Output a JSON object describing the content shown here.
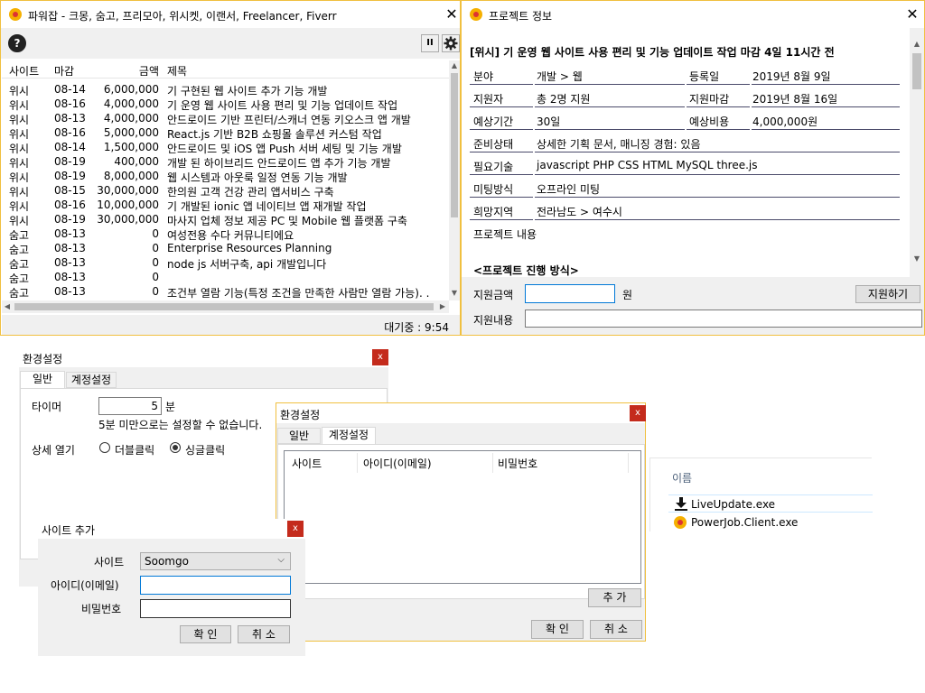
{
  "main_window": {
    "title": "파워잡 - 크몽, 숨고, 프리모아, 위시켓, 이랜서, Freelancer, Fiverr",
    "help_label": "?",
    "pause_label": "II",
    "settings_icon": "gear-icon",
    "columns": [
      "사이트",
      "마감",
      "금액",
      "제목"
    ],
    "rows": [
      {
        "site": "위시",
        "deadline": "08-14",
        "amount": "6,000,000",
        "title": "기 구현된 웹 사이트 추가 기능 개발"
      },
      {
        "site": "위시",
        "deadline": "08-16",
        "amount": "4,000,000",
        "title": "기 운영 웹 사이트 사용 편리 및 기능 업데이트 작업"
      },
      {
        "site": "위시",
        "deadline": "08-13",
        "amount": "4,000,000",
        "title": "안드로이드 기반 프린터/스캐너 연동 키오스크 앱 개발"
      },
      {
        "site": "위시",
        "deadline": "08-16",
        "amount": "5,000,000",
        "title": "React.js 기반 B2B 쇼핑몰 솔루션 커스텀 작업"
      },
      {
        "site": "위시",
        "deadline": "08-14",
        "amount": "1,500,000",
        "title": "안드로이드 및 iOS 앱 Push 서버 세팅 및 기능 개발"
      },
      {
        "site": "위시",
        "deadline": "08-19",
        "amount": "400,000",
        "title": "개발 된 하이브리드 안드로이드 앱 추가 기능 개발"
      },
      {
        "site": "위시",
        "deadline": "08-19",
        "amount": "8,000,000",
        "title": "웹 시스템과 아웃룩 일정 연동 기능 개발"
      },
      {
        "site": "위시",
        "deadline": "08-15",
        "amount": "30,000,000",
        "title": "한의원 고객 건강 관리 앱서비스 구축"
      },
      {
        "site": "위시",
        "deadline": "08-16",
        "amount": "10,000,000",
        "title": "기 개발된 ionic 앱 네이티브 앱 재개발 작업"
      },
      {
        "site": "위시",
        "deadline": "08-19",
        "amount": "30,000,000",
        "title": "마사지 업체 정보 제공 PC 및 Mobile 웹 플랫폼 구축"
      },
      {
        "site": "숨고",
        "deadline": "08-13",
        "amount": "0",
        "title": "여성전용 수다 커뮤니티에요"
      },
      {
        "site": "숨고",
        "deadline": "08-13",
        "amount": "0",
        "title": "Enterprise Resources Planning"
      },
      {
        "site": "숨고",
        "deadline": "08-13",
        "amount": "0",
        "title": "node js 서버구축, api 개발입니다"
      },
      {
        "site": "숨고",
        "deadline": "08-13",
        "amount": "0",
        "title": ""
      },
      {
        "site": "숨고",
        "deadline": "08-13",
        "amount": "0",
        "title": "조건부 열람 기능(특정 조건을 만족한 사람만 열람 가능). ."
      }
    ],
    "status": "대기중 : 9:54"
  },
  "project_window": {
    "title": "프로젝트 정보",
    "headline": "[위시] 기 운영 웹 사이트 사용 편리 및 기능 업데이트 작업 마감 4일 11시간 전",
    "fields": {
      "field_label": "분야",
      "field_value": "개발 > 웹",
      "reg_label": "등록일",
      "reg_value": "2019년 8월 9일",
      "applicants_label": "지원자",
      "applicants_value": "총 2명 지원",
      "apply_deadline_label": "지원마감",
      "apply_deadline_value": "2019년 8월 16일",
      "period_label": "예상기간",
      "period_value": "30일",
      "cost_label": "예상비용",
      "cost_value": "4,000,000원",
      "prep_label": "준비상태",
      "prep_value": "상세한 기획 문서, 매니징 경험: 있음",
      "skills_label": "필요기술",
      "skills_value": "javascript PHP CSS HTML MySQL three.js",
      "meeting_label": "미팅방식",
      "meeting_value": "오프라인 미팅",
      "region_label": "희망지역",
      "region_value": "전라남도 > 여수시",
      "content_label": "프로젝트 내용",
      "method_label": "<프로젝트 진행 방식>"
    },
    "apply_amount_label": "지원금액",
    "apply_amount_value": "",
    "won_label": "원",
    "apply_button": "지원하기",
    "apply_content_label": "지원내용",
    "apply_content_value": ""
  },
  "settings_general": {
    "title": "환경설정",
    "close_label": "x",
    "tab_general": "일반",
    "tab_account": "계정설정",
    "timer_label": "타이머",
    "timer_value": "5",
    "timer_unit": "분",
    "timer_note": "5분 미만으로는 설정할 수 없습니다.",
    "detail_label": "상세 열기",
    "radio_double": "더블클릭",
    "radio_single": "싱글클릭",
    "selected": "싱글클릭"
  },
  "settings_account": {
    "title": "환경설정",
    "close_label": "x",
    "tab_general": "일반",
    "tab_account": "계정설정",
    "columns": [
      "사이트",
      "아이디(이메일)",
      "비밀번호"
    ],
    "add_button": "추 가",
    "ok_button": "확 인",
    "cancel_button": "취 소"
  },
  "add_site": {
    "title": "사이트 추가",
    "close_label": "x",
    "site_label": "사이트",
    "site_value": "Soomgo",
    "id_label": "아이디(이메일)",
    "id_value": "",
    "pw_label": "비밀번호",
    "pw_value": "",
    "ok_button": "확 인",
    "cancel_button": "취 소"
  },
  "explorer": {
    "column_name": "이름",
    "files": [
      {
        "name": "LiveUpdate.exe",
        "icon": "download-icon"
      },
      {
        "name": "PowerJob.Client.exe",
        "icon": "app-icon"
      }
    ]
  }
}
